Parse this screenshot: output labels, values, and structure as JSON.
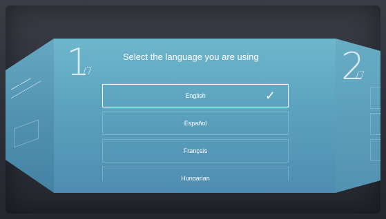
{
  "setup": {
    "step_current": {
      "number": "1",
      "total": "/7"
    },
    "step_next": {
      "number": "2",
      "total": "/7"
    },
    "title": "Select the language you are using",
    "languages": [
      {
        "label": "English",
        "selected": true
      },
      {
        "label": "Español",
        "selected": false
      },
      {
        "label": "Français",
        "selected": false
      },
      {
        "label": "Hungarian",
        "selected": false
      }
    ],
    "check_icon": "check-icon"
  },
  "colors": {
    "panel_top": "#79c2d3",
    "panel_bottom": "#4a86ad",
    "background": "#2b2e37"
  }
}
